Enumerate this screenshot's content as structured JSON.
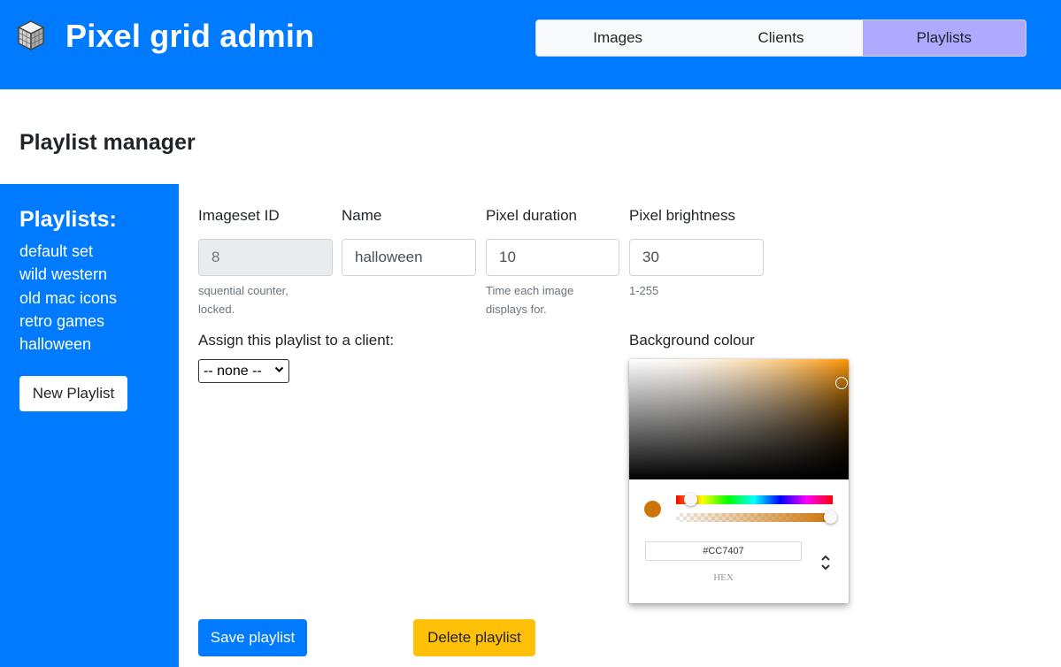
{
  "header": {
    "title": "Pixel grid admin",
    "logo_icon": "cube-icon",
    "tabs": [
      {
        "label": "Images",
        "active": false
      },
      {
        "label": "Clients",
        "active": false
      },
      {
        "label": "Playlists",
        "active": true
      }
    ]
  },
  "page": {
    "heading": "Playlist manager"
  },
  "sidebar": {
    "title": "Playlists:",
    "items": [
      "default set",
      "wild western",
      "old mac icons",
      "retro games",
      "halloween"
    ],
    "new_button": "New Playlist"
  },
  "form": {
    "imageset_id": {
      "label": "Imageset ID",
      "value": "8",
      "help": "squential counter, locked."
    },
    "name": {
      "label": "Name",
      "value": "halloween"
    },
    "pixel_duration": {
      "label": "Pixel duration",
      "value": "10",
      "help": "Time each image displays for."
    },
    "pixel_brightness": {
      "label": "Pixel brightness",
      "value": "30",
      "help": "1-255"
    },
    "assign_label": "Assign this playlist to a client:",
    "client_select": {
      "selected": "-- none --"
    },
    "background": {
      "label": "Background colour",
      "hex": "#CC7407",
      "mode_label": "HEX",
      "color": "#cc7407",
      "hue_color": "#ff9500",
      "alpha": 1.0
    },
    "save_button": "Save playlist",
    "delete_button": "Delete playlist"
  },
  "colors": {
    "primary": "#007bff",
    "active_tab": "#adaaff",
    "warning": "#ffc107"
  }
}
